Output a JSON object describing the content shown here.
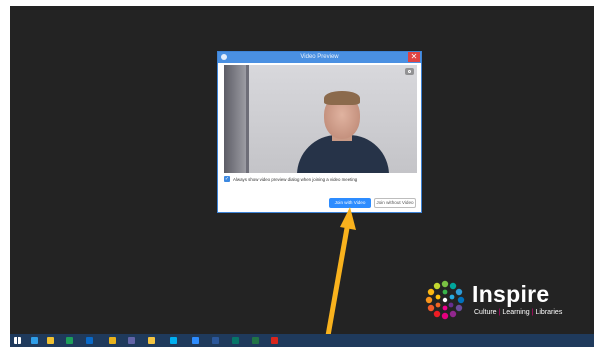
{
  "dialog": {
    "title": "Video Preview",
    "checkbox_label": "Always show video preview dialog when joining a video meeting",
    "checkbox_checked": true,
    "join_with_video_label": "Join with Video",
    "join_without_video_label": "Join without Video"
  },
  "logo": {
    "name": "Inspire",
    "tagline_parts": [
      "Culture",
      "Learning",
      "Libraries"
    ],
    "tagline_separator": "|"
  },
  "taskbar": {
    "items": [
      {
        "icon": "windows-start-icon",
        "color": "#ffffff"
      },
      {
        "icon": "internet-explorer-icon",
        "color": "#2f9ee8"
      },
      {
        "icon": "file-explorer-icon",
        "color": "#f1c232"
      },
      {
        "icon": "store-icon",
        "color": "#1e9f5a"
      },
      {
        "icon": "outlook-icon",
        "color": "#0a6ac9"
      },
      {
        "icon": "chrome-icon",
        "color": "#e8b21c"
      },
      {
        "icon": "teams-icon",
        "color": "#6264a7"
      },
      {
        "icon": "folder-icon",
        "color": "#f4c542"
      },
      {
        "icon": "skype-icon",
        "color": "#00aff0"
      },
      {
        "icon": "zoom-icon",
        "color": "#2d8cff"
      },
      {
        "icon": "word-icon",
        "color": "#2b579a"
      },
      {
        "icon": "publisher-icon",
        "color": "#077568"
      },
      {
        "icon": "excel-icon",
        "color": "#217346"
      },
      {
        "icon": "acrobat-icon",
        "color": "#d9261c"
      }
    ]
  },
  "colors": {
    "accent_blue": "#2d8cff",
    "annotation_arrow": "#f9b21d",
    "desktop_background": "#232323"
  }
}
